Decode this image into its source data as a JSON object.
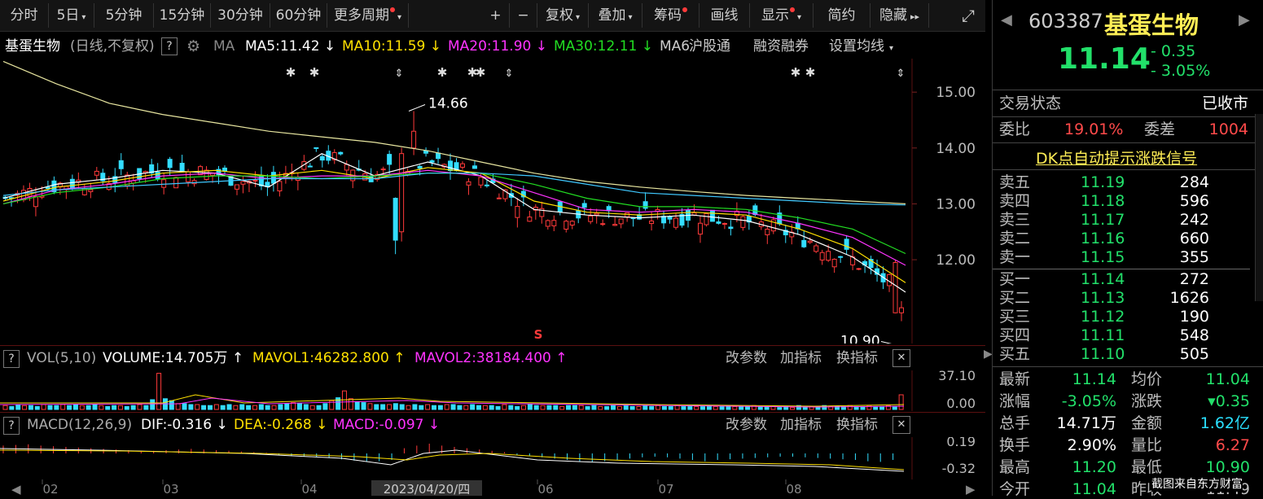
{
  "toolbar": {
    "buttons": [
      {
        "label": "分时",
        "dot": false,
        "arrow": false
      },
      {
        "label": "5日",
        "dot": false,
        "arrow": true
      },
      {
        "label": "5分钟",
        "dot": false,
        "arrow": false
      },
      {
        "label": "15分钟",
        "dot": false,
        "arrow": false
      },
      {
        "label": "30分钟",
        "dot": false,
        "arrow": false
      },
      {
        "label": "60分钟",
        "dot": false,
        "arrow": false
      },
      {
        "label": "更多周期",
        "dot": true,
        "arrow": true
      },
      {
        "label": "+",
        "dot": false,
        "arrow": false
      },
      {
        "label": "−",
        "dot": false,
        "arrow": false
      },
      {
        "label": "复权",
        "dot": false,
        "arrow": true
      },
      {
        "label": "叠加",
        "dot": false,
        "arrow": true
      },
      {
        "label": "筹码",
        "dot": true,
        "arrow": false
      },
      {
        "label": "画线",
        "dot": false,
        "arrow": false
      },
      {
        "label": "显示",
        "dot": true,
        "arrow": true
      },
      {
        "label": "简约",
        "dot": false,
        "arrow": false
      },
      {
        "label": "隐藏",
        "dot": false,
        "arrow": false
      }
    ],
    "hide_glyph": "▸▸",
    "expand_glyph": "⤢"
  },
  "ma_line": {
    "stock": "基蛋生物",
    "mode": "(日线,不复权)",
    "help": "?",
    "ma_label": "MA",
    "ma5": "MA5:11.42",
    "ma10": "MA10:11.59",
    "ma20": "MA20:11.90",
    "ma30": "MA30:12.11",
    "ma6": "MA6",
    "link1": "沪股通",
    "link2": "融资融券",
    "link3": "设置均线",
    "down_arrow": "↓",
    "colors": {
      "ma5": "#ffffff",
      "ma10": "#ffe000",
      "ma20": "#ff33ff",
      "ma30": "#22dd22",
      "ma60": "#3fc8ff"
    }
  },
  "vol_header": {
    "help": "?",
    "name": "VOL(5,10)",
    "volume": "VOLUME:14.705万",
    "mavol1": "MAVOL1:46282.800",
    "mavol2": "MAVOL2:38184.400",
    "up_arrow": "↑",
    "params": "改参数",
    "add": "加指标",
    "switch": "换指标",
    "close": "✕"
  },
  "macd_header": {
    "help": "?",
    "name": "MACD(12,26,9)",
    "dif": "DIF:-0.316",
    "dea": "DEA:-0.268",
    "macd": "MACD:-0.097",
    "down_arrow": "↓",
    "params": "改参数",
    "add": "加指标",
    "switch": "换指标",
    "close": "✕"
  },
  "chart_data": [
    {
      "type": "candlestick",
      "title": "基蛋生物 (日线,不复权)",
      "ylim": [
        10.5,
        15.6
      ],
      "y_ticks": [
        "15.00",
        "14.00",
        "13.00",
        "12.00"
      ],
      "y_tick_values": [
        15,
        14,
        13,
        12
      ],
      "annotations": [
        {
          "text": "14.66",
          "value": 14.66
        },
        {
          "text": "10.90",
          "value": 10.9
        }
      ],
      "signal_marker": "S",
      "month_labels": [
        "02",
        "03",
        "04",
        "06",
        "07",
        "08"
      ],
      "cursor_date": "2023/04/20/四",
      "ma_series": [
        {
          "name": "MA5",
          "values": [
            13.1,
            13.35,
            13.45,
            13.6,
            13.55,
            13.3,
            13.9,
            13.5,
            13.75,
            13.5,
            12.9,
            12.8,
            12.75,
            12.8,
            12.7,
            12.45,
            12.05,
            11.42
          ]
        },
        {
          "name": "MA10",
          "values": [
            13.05,
            13.3,
            13.4,
            13.55,
            13.6,
            13.5,
            13.6,
            13.45,
            13.65,
            13.55,
            13.05,
            12.85,
            12.8,
            12.85,
            12.8,
            12.55,
            12.2,
            11.59
          ]
        },
        {
          "name": "MA20",
          "values": [
            13.0,
            13.25,
            13.35,
            13.5,
            13.55,
            13.45,
            13.5,
            13.5,
            13.6,
            13.5,
            13.2,
            12.9,
            12.85,
            12.9,
            12.85,
            12.65,
            12.4,
            11.9
          ]
        },
        {
          "name": "MA30",
          "values": [
            13.0,
            13.2,
            13.3,
            13.45,
            13.5,
            13.5,
            13.45,
            13.5,
            13.55,
            13.55,
            13.35,
            13.1,
            12.95,
            12.95,
            12.9,
            12.75,
            12.55,
            12.11
          ]
        },
        {
          "name": "MA60",
          "values": [
            13.15,
            13.25,
            13.3,
            13.35,
            13.4,
            13.45,
            13.45,
            13.45,
            13.55,
            13.55,
            13.5,
            13.35,
            13.2,
            13.15,
            13.1,
            13.05,
            13.0,
            12.98
          ]
        },
        {
          "name": "MA120",
          "values": [
            15.55,
            15.15,
            14.8,
            14.6,
            14.45,
            14.3,
            14.2,
            14.1,
            13.95,
            13.75,
            13.55,
            13.4,
            13.3,
            13.22,
            13.15,
            13.1,
            13.05,
            13.0
          ]
        }
      ]
    },
    {
      "type": "bar",
      "title": "VOL(5,10)",
      "y_ticks": [
        "37.10",
        "0.00"
      ],
      "ylim": [
        0,
        40
      ],
      "values": [
        4,
        3,
        5,
        4,
        4,
        3,
        5,
        4,
        4,
        5,
        4,
        5,
        4,
        4,
        5,
        4,
        3,
        4,
        4,
        3,
        4,
        5,
        4,
        10,
        37,
        11,
        9,
        6,
        6,
        5,
        5,
        4,
        4,
        5,
        4,
        5,
        4,
        5,
        4,
        4,
        5,
        4,
        4,
        5,
        6,
        7,
        6,
        5,
        4,
        4,
        6,
        9,
        12,
        19,
        11,
        8,
        7,
        6,
        5,
        5,
        5,
        6,
        5,
        4,
        5,
        4,
        5,
        4,
        4,
        5,
        5,
        4,
        4,
        5,
        4,
        4,
        4,
        3,
        5,
        4,
        3,
        4,
        5,
        4,
        4,
        4,
        4,
        3,
        4,
        4,
        4,
        3,
        4,
        3,
        3,
        4,
        3,
        4,
        3,
        3,
        4,
        3,
        4,
        3,
        3,
        4,
        3,
        4,
        3,
        3,
        4,
        3,
        3,
        4,
        3,
        3,
        3,
        4,
        3,
        3,
        3,
        2,
        3,
        2,
        4,
        3,
        3,
        3,
        4,
        3,
        3,
        3,
        4,
        3,
        3,
        4,
        3,
        3,
        4,
        3,
        15
      ]
    },
    {
      "type": "bar",
      "title": "MACD(12,26,9)",
      "y_ticks": [
        "0.19",
        "-0.32"
      ],
      "ylim": [
        -0.4,
        0.25
      ],
      "values": [
        0.12,
        0.13,
        0.14,
        0.12,
        0.11,
        0.1,
        0.09,
        0.08,
        0.07,
        0.06,
        0.05,
        0.04,
        0.04,
        0.05,
        0.06,
        0.07,
        0.06,
        0.05,
        0.04,
        0.03,
        0.02,
        0.01,
        -0.02,
        -0.04,
        -0.05,
        -0.06,
        -0.07,
        -0.09,
        -0.11,
        -0.13,
        -0.12,
        -0.1,
        0.08,
        0.12,
        0.15,
        0.12,
        0.1,
        0.08,
        0.06,
        0.04,
        0.02,
        -0.02,
        -0.04,
        -0.06,
        -0.08,
        -0.1,
        -0.12,
        -0.13,
        -0.12,
        -0.1,
        -0.08,
        -0.06,
        -0.05,
        -0.06,
        -0.08,
        -0.1,
        -0.12,
        -0.1,
        -0.09,
        -0.08,
        -0.07,
        -0.06,
        -0.05,
        -0.05,
        -0.06,
        -0.07,
        -0.08,
        -0.09,
        -0.1,
        -0.12,
        -0.13,
        -0.1
      ]
    }
  ],
  "right_panel": {
    "code": "603387",
    "name": "基蛋生物",
    "price": "11.14",
    "change": "- 0.35",
    "change_pct": "- 3.05%",
    "status_label": "交易状态",
    "status_value": "已收市",
    "weibi_label": "委比",
    "weibi_value": "19.01%",
    "weicha_label": "委差",
    "weicha_value": "1004",
    "dk_label": "DK点自动提示涨跌信号",
    "asks": [
      {
        "label": "卖五",
        "price": "11.19",
        "vol": "284"
      },
      {
        "label": "卖四",
        "price": "11.18",
        "vol": "596"
      },
      {
        "label": "卖三",
        "price": "11.17",
        "vol": "242"
      },
      {
        "label": "卖二",
        "price": "11.16",
        "vol": "660"
      },
      {
        "label": "卖一",
        "price": "11.15",
        "vol": "355"
      }
    ],
    "bids": [
      {
        "label": "买一",
        "price": "11.14",
        "vol": "272"
      },
      {
        "label": "买二",
        "price": "11.13",
        "vol": "1626"
      },
      {
        "label": "买三",
        "price": "11.12",
        "vol": "190"
      },
      {
        "label": "买四",
        "price": "11.11",
        "vol": "548"
      },
      {
        "label": "买五",
        "price": "11.10",
        "vol": "505"
      }
    ],
    "stats": [
      {
        "l1": "最新",
        "v1": "11.14",
        "c1": "grn",
        "l2": "均价",
        "v2": "11.04",
        "c2": "grn"
      },
      {
        "l1": "涨幅",
        "v1": "-3.05%",
        "c1": "grn",
        "l2": "涨跌",
        "v2": "▾0.35",
        "c2": "grn"
      },
      {
        "l1": "总手",
        "v1": "14.71万",
        "c1": "wht",
        "l2": "金额",
        "v2": "1.62亿",
        "c2": "cyan"
      },
      {
        "l1": "换手",
        "v1": "2.90%",
        "c1": "wht",
        "l2": "量比",
        "v2": "6.27",
        "c2": "red"
      },
      {
        "l1": "最高",
        "v1": "11.20",
        "c1": "grn",
        "l2": "最低",
        "v2": "10.90",
        "c2": "grn"
      },
      {
        "l1": "今开",
        "v1": "11.04",
        "c1": "grn",
        "l2": "昨收",
        "v2": "11.49",
        "c2": "gry"
      }
    ],
    "watermark": "截图来自东方财富",
    "left_arrow": "◀",
    "right_arrow": "▶"
  }
}
